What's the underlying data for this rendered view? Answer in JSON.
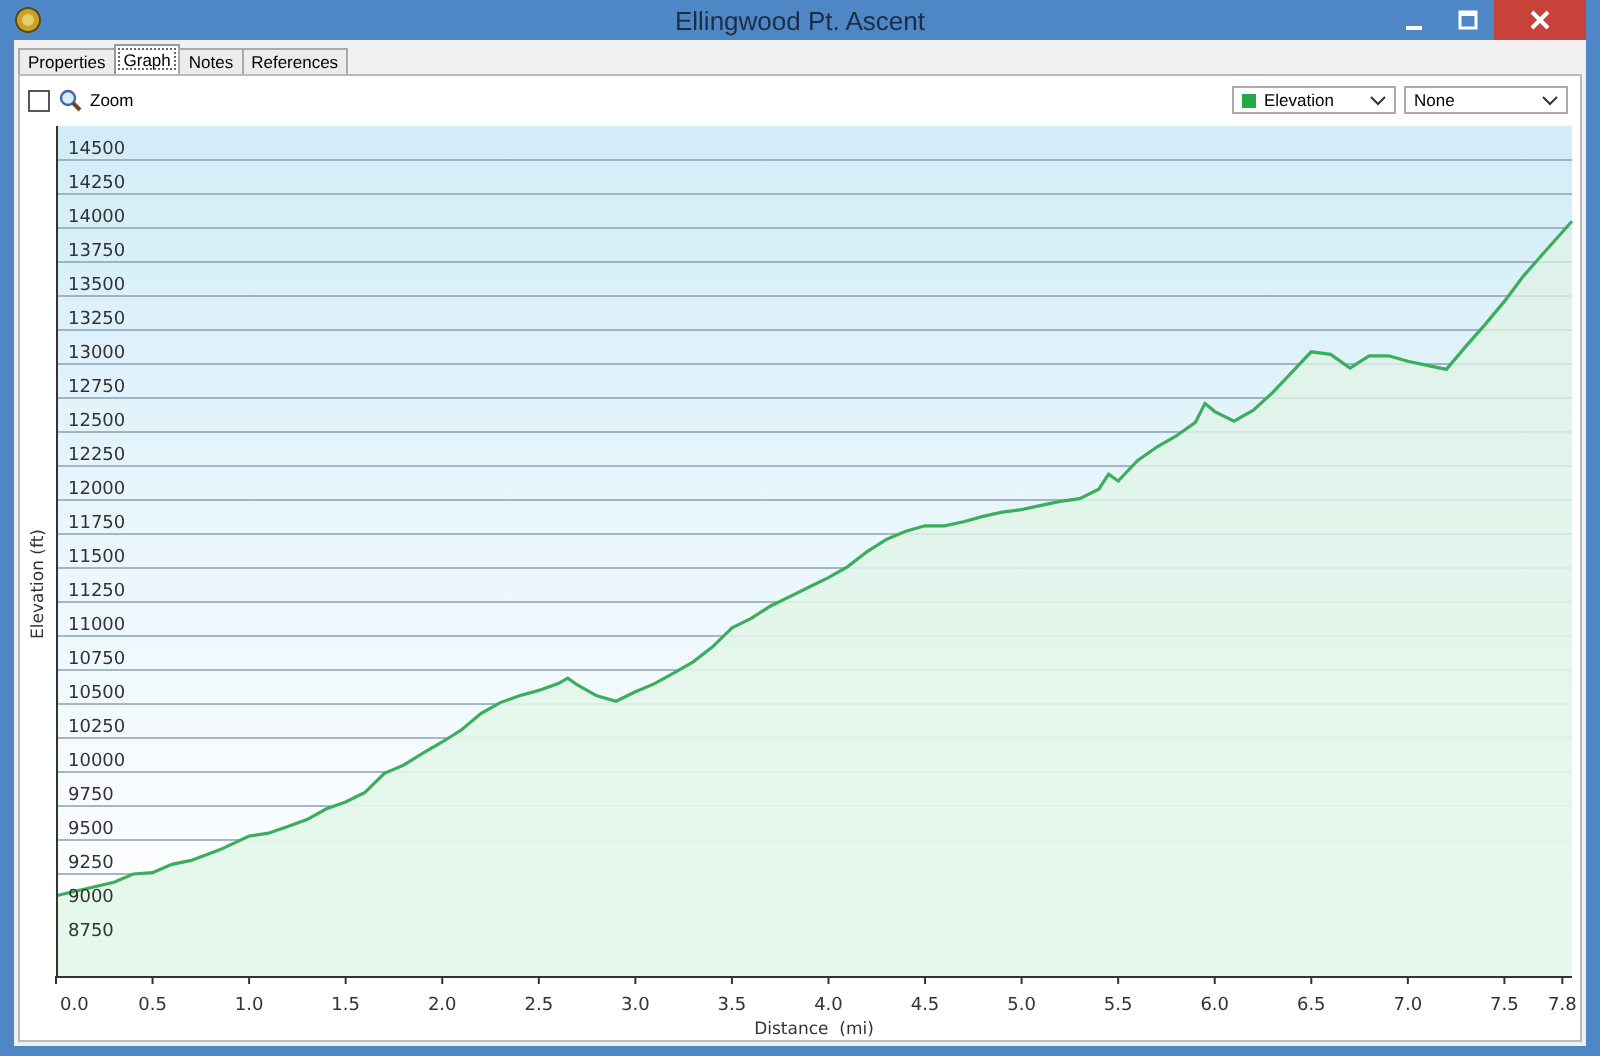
{
  "window": {
    "title": "Ellingwood Pt. Ascent"
  },
  "tabs": [
    {
      "label": "Properties",
      "selected": false
    },
    {
      "label": "Graph",
      "selected": true
    },
    {
      "label": "Notes",
      "selected": false
    },
    {
      "label": "References",
      "selected": false
    }
  ],
  "toolbar": {
    "zoom": {
      "label": "Zoom",
      "checked": false
    },
    "series_select": {
      "color": "#22aa44"
    },
    "second_select": {
      "value": "None"
    }
  },
  "graph": {
    "chart_data": {
      "type": "area",
      "xlabel": "Distance  (mi)",
      "ylabel": "Elevation (ft)",
      "x": [
        0,
        0.15,
        0.3,
        0.4,
        0.5,
        0.6,
        0.7,
        0.85,
        1.0,
        1.1,
        1.2,
        1.3,
        1.4,
        1.5,
        1.6,
        1.7,
        1.8,
        1.9,
        2.0,
        2.1,
        2.2,
        2.3,
        2.4,
        2.5,
        2.6,
        2.65,
        2.7,
        2.8,
        2.9,
        3.0,
        3.1,
        3.2,
        3.3,
        3.4,
        3.5,
        3.6,
        3.7,
        3.8,
        3.9,
        4.0,
        4.1,
        4.2,
        4.3,
        4.4,
        4.5,
        4.6,
        4.7,
        4.8,
        4.9,
        5.0,
        5.1,
        5.2,
        5.3,
        5.4,
        5.45,
        5.5,
        5.6,
        5.7,
        5.8,
        5.9,
        5.95,
        6.0,
        6.1,
        6.2,
        6.3,
        6.4,
        6.5,
        6.6,
        6.7,
        6.8,
        6.9,
        7.0,
        7.1,
        7.2,
        7.3,
        7.4,
        7.5,
        7.6,
        7.7,
        7.8,
        7.85
      ],
      "series": [
        {
          "name": "Elevation",
          "color": "#3aae5c",
          "values": [
            9090,
            9140,
            9190,
            9250,
            9260,
            9320,
            9350,
            9430,
            9530,
            9550,
            9600,
            9650,
            9730,
            9780,
            9850,
            9990,
            10050,
            10140,
            10220,
            10310,
            10430,
            10510,
            10560,
            10600,
            10650,
            10690,
            10640,
            10560,
            10520,
            10590,
            10650,
            10730,
            10810,
            10920,
            11060,
            11130,
            11220,
            11290,
            11360,
            11430,
            11510,
            11620,
            11710,
            11770,
            11810,
            11810,
            11840,
            11880,
            11910,
            11930,
            11960,
            11990,
            12010,
            12080,
            12190,
            12140,
            12290,
            12390,
            12470,
            12570,
            12710,
            12650,
            12580,
            12660,
            12790,
            12940,
            13090,
            13070,
            12970,
            13060,
            13060,
            13020,
            12990,
            12960,
            13130,
            13290,
            13460,
            13650,
            13810,
            13970,
            14050
          ]
        }
      ],
      "xlim": [
        0,
        7.85
      ],
      "ylim": [
        8500,
        14750
      ],
      "grid": true,
      "xticks": [
        {
          "value": 0,
          "label": "0.0"
        },
        0.5,
        {
          "value": 1,
          "label": "1.0"
        },
        1.5,
        {
          "value": 2,
          "label": "2.0"
        },
        2.5,
        {
          "value": 3,
          "label": "3.0"
        },
        3.5,
        {
          "value": 4,
          "label": "4.0"
        },
        4.5,
        {
          "value": 5,
          "label": "5.0"
        },
        5.5,
        {
          "value": 6,
          "label": "6.0"
        },
        6.5,
        {
          "value": 7,
          "label": "7.0"
        },
        7.5,
        7.8
      ],
      "yticks": [
        8750,
        9000,
        9250,
        9500,
        9750,
        10000,
        10250,
        10500,
        10750,
        11000,
        11250,
        11500,
        11750,
        12000,
        12250,
        12500,
        12750,
        13000,
        13250,
        13500,
        13750,
        14000,
        14250,
        14500
      ]
    }
  }
}
